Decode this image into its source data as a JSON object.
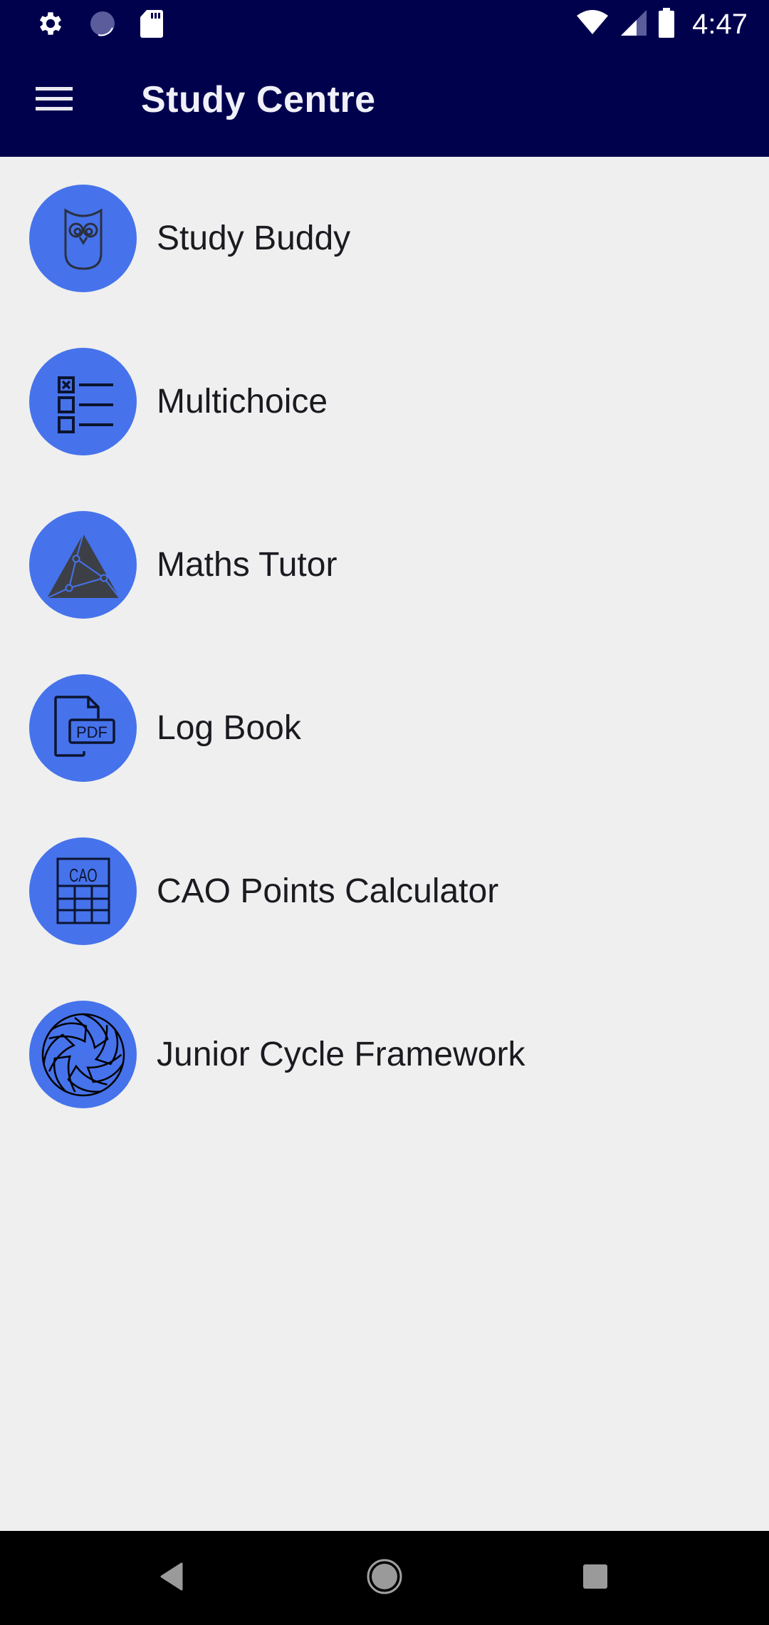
{
  "status_bar": {
    "time": "4:47",
    "left_icons": [
      "gear-icon",
      "sync-progress-icon",
      "sd-card-icon"
    ],
    "right_icons": [
      "wifi-icon",
      "cell-signal-icon",
      "battery-icon"
    ]
  },
  "app_bar": {
    "title": "Study Centre",
    "menu_icon": "hamburger-menu-icon",
    "background_color": "#00014d"
  },
  "menu": {
    "accent_color": "#4673eb",
    "items": [
      {
        "label": "Study Buddy",
        "icon": "owl-icon"
      },
      {
        "label": "Multichoice",
        "icon": "checklist-icon"
      },
      {
        "label": "Maths Tutor",
        "icon": "triangle-geometry-icon"
      },
      {
        "label": "Log Book",
        "icon": "pdf-file-icon"
      },
      {
        "label": "CAO Points Calculator",
        "icon": "cao-calculator-icon"
      },
      {
        "label": "Junior Cycle Framework",
        "icon": "aperture-icon"
      }
    ]
  },
  "nav_bar": {
    "buttons": [
      "back",
      "home",
      "recents"
    ]
  }
}
